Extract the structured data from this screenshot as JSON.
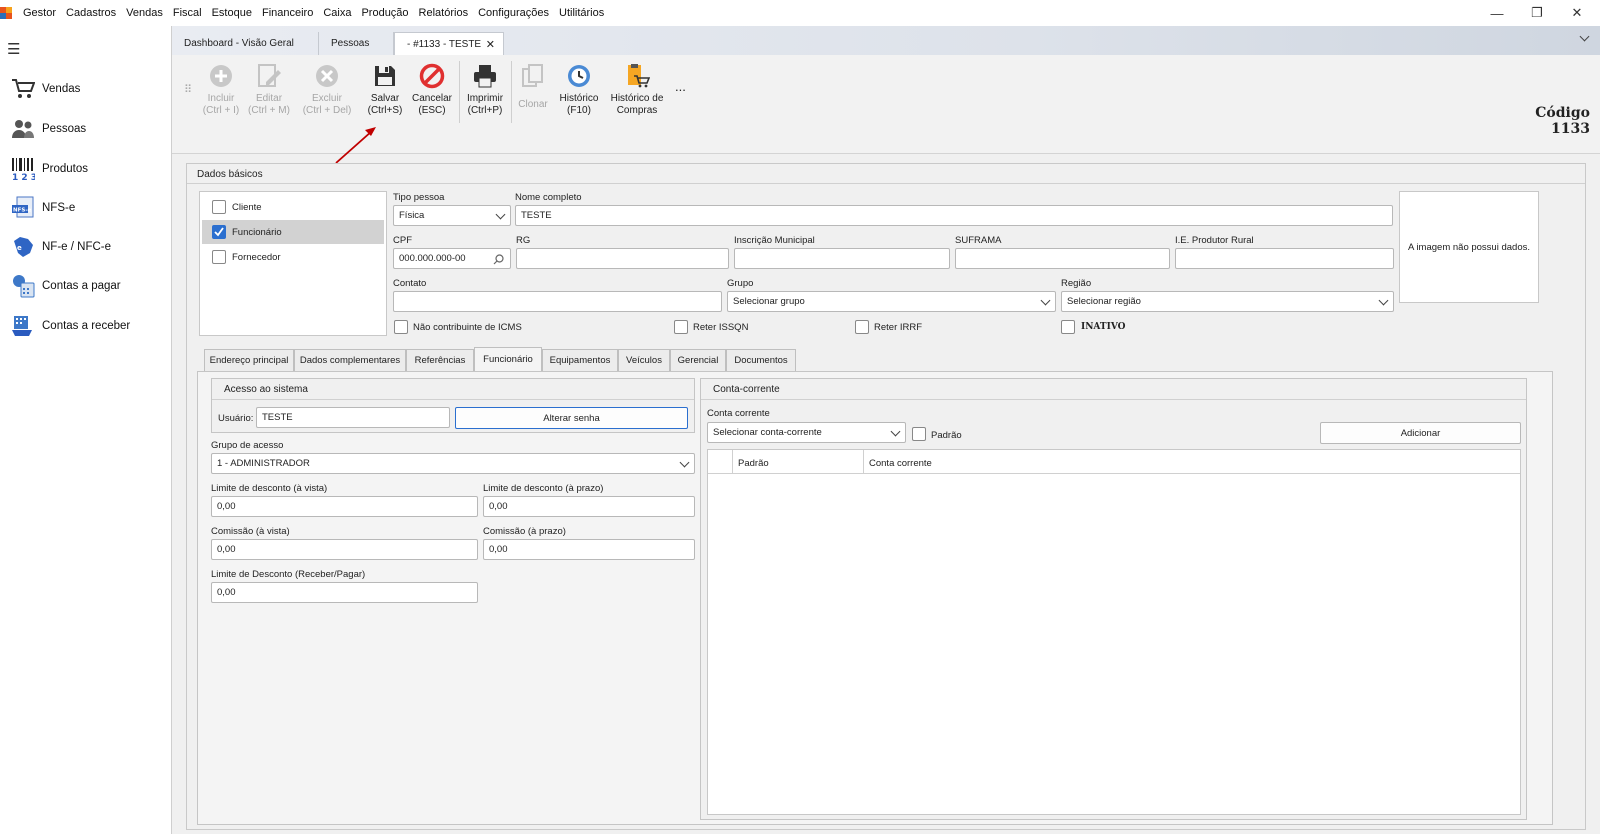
{
  "menu": {
    "items": [
      "Gestor",
      "Cadastros",
      "Vendas",
      "Fiscal",
      "Estoque",
      "Financeiro",
      "Caixa",
      "Produção",
      "Relatórios",
      "Configurações",
      "Utilitários"
    ]
  },
  "window": {
    "minimize": "—",
    "maximize": "❐",
    "close": "✕"
  },
  "sidebar": {
    "items": [
      {
        "label": "Vendas"
      },
      {
        "label": "Pessoas"
      },
      {
        "label": "Produtos"
      },
      {
        "label": "NFS-e"
      },
      {
        "label": "NF-e / NFC-e"
      },
      {
        "label": "Contas a pagar"
      },
      {
        "label": "Contas a receber"
      }
    ]
  },
  "tabs": [
    {
      "label": "Dashboard - Visão Geral"
    },
    {
      "label": "Pessoas"
    },
    {
      "label": "- #1133 - TESTE"
    }
  ],
  "toolbar": {
    "incluir": [
      "Incluir",
      "(Ctrl + I)"
    ],
    "editar": [
      "Editar",
      "(Ctrl + M)"
    ],
    "excluir": [
      "Excluir",
      "(Ctrl + Del)"
    ],
    "salvar": [
      "Salvar",
      "(Ctrl+S)"
    ],
    "cancelar": [
      "Cancelar",
      "(ESC)"
    ],
    "imprimir": [
      "Imprimir",
      "(Ctrl+P)"
    ],
    "clonar": [
      "Clonar"
    ],
    "historico": [
      "Histórico",
      "(F10)"
    ],
    "historico_compras": [
      "Histórico de",
      "Compras"
    ],
    "more": "..."
  },
  "codigo": {
    "label": "Código",
    "value": "1133"
  },
  "dados_basicos": {
    "title": "Dados básicos",
    "roles": [
      {
        "label": "Cliente",
        "checked": false
      },
      {
        "label": "Funcionário",
        "checked": true
      },
      {
        "label": "Fornecedor",
        "checked": false
      }
    ],
    "tipo_pessoa": {
      "label": "Tipo pessoa",
      "value": "Física"
    },
    "nome": {
      "label": "Nome completo",
      "value": "TESTE"
    },
    "cpf": {
      "label": "CPF",
      "value": "000.000.000-00"
    },
    "rg": {
      "label": "RG",
      "value": ""
    },
    "inscricao": {
      "label": "Inscrição Municipal",
      "value": ""
    },
    "suframa": {
      "label": "SUFRAMA",
      "value": ""
    },
    "ie": {
      "label": "I.E. Produtor Rural",
      "value": ""
    },
    "contato": {
      "label": "Contato",
      "value": ""
    },
    "grupo": {
      "label": "Grupo",
      "value": "Selecionar grupo"
    },
    "regiao": {
      "label": "Região",
      "value": "Selecionar região"
    },
    "nao_contribuinte": "Não contribuinte de ICMS",
    "reter_issqn": "Reter ISSQN",
    "reter_irrf": "Reter IRRF",
    "inativo": "INATIVO",
    "imagem": "A imagem não possui dados."
  },
  "subtabs": [
    "Endereço principal",
    "Dados complementares",
    "Referências",
    "Funcionário",
    "Equipamentos",
    "Veículos",
    "Gerencial",
    "Documentos"
  ],
  "funcionario": {
    "acesso_title": "Acesso ao sistema",
    "usuario_label": "Usuário:",
    "usuario_value": "TESTE",
    "alterar_senha": "Alterar senha",
    "grupo_acesso_label": "Grupo de acesso",
    "grupo_acesso_value": "1 - ADMINISTRADOR",
    "lim_vista_label": "Limite de desconto (à vista)",
    "lim_vista_value": "0,00",
    "lim_prazo_label": "Limite de desconto (à prazo)",
    "lim_prazo_value": "0,00",
    "com_vista_label": "Comissão (à vista)",
    "com_vista_value": "0,00",
    "com_prazo_label": "Comissão (à prazo)",
    "com_prazo_value": "0,00",
    "lim_receber_label": "Limite de Desconto (Receber/Pagar)",
    "lim_receber_value": "0,00"
  },
  "conta_corrente": {
    "title": "Conta-corrente",
    "label": "Conta corrente",
    "select": "Selecionar conta-corrente",
    "padrao": "Padrão",
    "adicionar": "Adicionar",
    "col_padrao": "Padrão",
    "col_conta": "Conta corrente"
  },
  "colors": {
    "accent": "#2b6fcf",
    "cancel": "#e03030",
    "arrow": "#c00000"
  }
}
